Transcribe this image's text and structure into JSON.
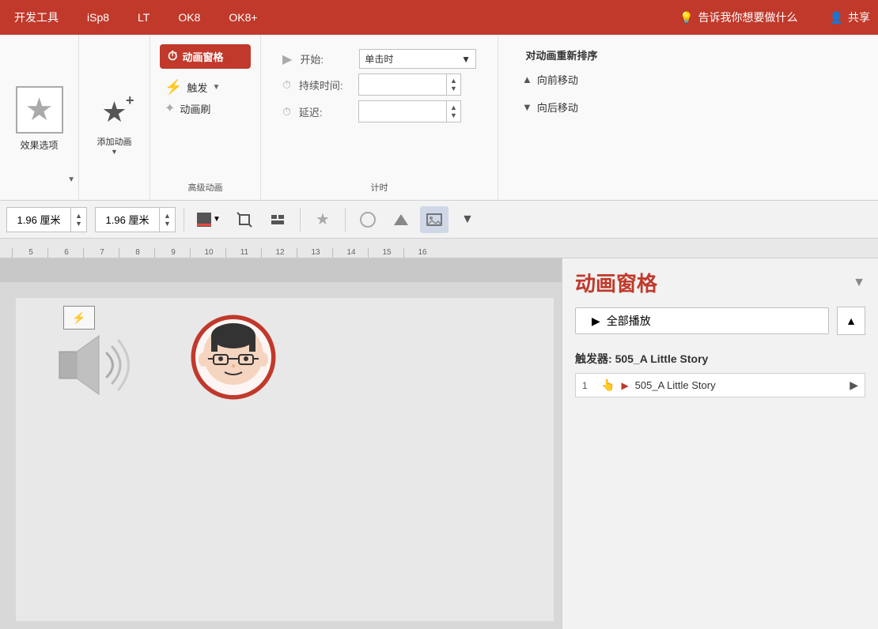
{
  "menubar": {
    "items": [
      "开发工具",
      "iSp8",
      "LT",
      "OK8",
      "OK8+"
    ],
    "search_icon": "💡",
    "search_text": "告诉我你想要做什么",
    "user_icon": "👤",
    "share_text": "共享"
  },
  "ribbon": {
    "effect_options_label": "效果选项",
    "add_animation_label": "添加动画",
    "animation_pane_label": "动画窗格",
    "trigger_label": "触发",
    "animation_brush_label": "动画刷",
    "advanced_animation_section": "高级动画",
    "start_label": "开始:",
    "start_value": "单击时",
    "duration_label": "持续时间:",
    "delay_label": "延迟:",
    "timing_section": "计时",
    "reorder_title": "对动画重新排序",
    "move_forward_label": "向前移动",
    "move_back_label": "向后移动"
  },
  "toolbar": {
    "size1_value": "1.96 厘米",
    "size2_value": "1.96 厘米"
  },
  "ruler": {
    "ticks": [
      "5",
      "6",
      "7",
      "8",
      "9",
      "10",
      "11",
      "12",
      "13",
      "14",
      "15",
      "16"
    ]
  },
  "anim_pane": {
    "title": "动画窗格",
    "play_all_label": "全部播放",
    "trigger_prefix": "触发器: ",
    "trigger_name": "505_A Little Story",
    "anim_item_num": "1",
    "anim_item_name": "505_A Little Story"
  }
}
